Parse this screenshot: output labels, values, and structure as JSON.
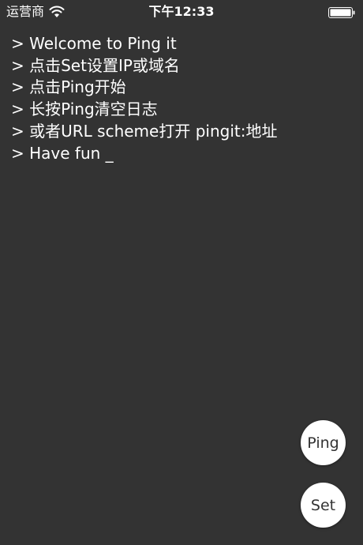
{
  "status_bar": {
    "carrier": "运营商",
    "time": "下午12:33",
    "wifi_icon": "wifi-icon",
    "battery_icon": "battery-icon"
  },
  "log": {
    "lines": [
      "> Welcome to Ping it",
      "> 点击Set设置IP或域名",
      "> 点击Ping开始",
      "> 长按Ping清空日志",
      "> 或者URL scheme打开 pingit:地址",
      "> Have fun _"
    ]
  },
  "buttons": {
    "ping_label": "Ping",
    "set_label": "Set"
  },
  "colors": {
    "background": "#333333",
    "text": "#ffffff",
    "button_bg": "#ffffff",
    "button_text": "#333333"
  }
}
